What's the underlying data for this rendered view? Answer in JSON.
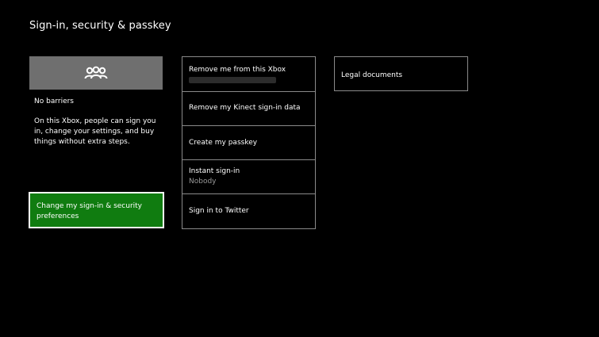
{
  "page": {
    "title": "Sign-in, security & passkey"
  },
  "left": {
    "tile_icon": "people-group-icon",
    "barrier_label": "No barriers",
    "barrier_description": "On this Xbox, people can sign you in, change your settings, and buy things without extra steps.",
    "prefs_button_label": "Change my sign-in & security preferences",
    "prefs_button_color": "#107c10"
  },
  "menu": {
    "items": [
      {
        "label": "Remove me from this Xbox"
      },
      {
        "label": "Remove my Kinect sign-in data"
      },
      {
        "label": "Create my passkey"
      },
      {
        "label": "Instant sign-in",
        "value": "Nobody"
      },
      {
        "label": "Sign in to Twitter"
      }
    ]
  },
  "right": {
    "legal_label": "Legal documents"
  }
}
